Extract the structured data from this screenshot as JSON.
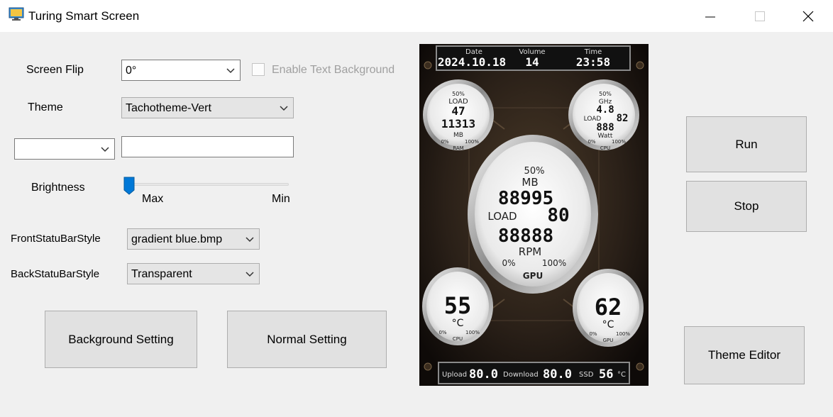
{
  "window": {
    "title": "Turing Smart Screen"
  },
  "controls": {
    "screen_flip_label": "Screen Flip",
    "screen_flip_value": "0°",
    "enable_text_bg_label": "Enable Text Background",
    "theme_label": "Theme",
    "theme_value": "Tachotheme-Vert",
    "brightness_label": "Brightness",
    "brightness_max": "Max",
    "brightness_min": "Min",
    "brightness_level": 0,
    "front_bar_label": "FrontStatuBarStyle",
    "front_bar_value": "gradient blue.bmp",
    "back_bar_label": "BackStatuBarStyle",
    "back_bar_value": "Transparent"
  },
  "buttons": {
    "background_setting": "Background Setting",
    "normal_setting": "Normal Setting",
    "run": "Run",
    "stop": "Stop",
    "theme_editor": "Theme Editor"
  },
  "preview": {
    "header": {
      "date_label": "Date",
      "date_value": "2024.10.18",
      "volume_label": "Volume",
      "volume_value": "14",
      "time_label": "Time",
      "time_value": "23:58"
    },
    "ram_gauge": {
      "pct": "50%",
      "load_label": "LOAD",
      "load_value": "47",
      "mb_value": "11313",
      "mb_label": "MB",
      "min": "0%",
      "max": "100%",
      "name": "RAM"
    },
    "cpu_gauge": {
      "pct": "50%",
      "ghz_label": "GHz",
      "ghz_value": "4.8",
      "load_label": "LOAD",
      "load_value": "82",
      "watt_value": "888",
      "watt_label": "Watt",
      "min": "0%",
      "max": "100%",
      "name": "CPU"
    },
    "gpu_gauge": {
      "pct": "50%",
      "mb_label": "MB",
      "mb_value": "88995",
      "load_label": "LOAD",
      "load_value": "80",
      "rpm_value": "88888",
      "rpm_label": "RPM",
      "min": "0%",
      "max": "100%",
      "name": "GPU"
    },
    "cpu_temp": {
      "value": "55",
      "unit": "°C",
      "min": "0%",
      "max": "100%",
      "name": "CPU"
    },
    "gpu_temp": {
      "value": "62",
      "unit": "°C",
      "min": "0%",
      "max": "100%",
      "name": "GPU"
    },
    "footer": {
      "upload_label": "Upload",
      "upload_value": "80.0",
      "download_label": "Download",
      "download_value": "80.0",
      "ssd_label": "SSD",
      "ssd_value": "56",
      "ssd_unit": "°C"
    }
  }
}
